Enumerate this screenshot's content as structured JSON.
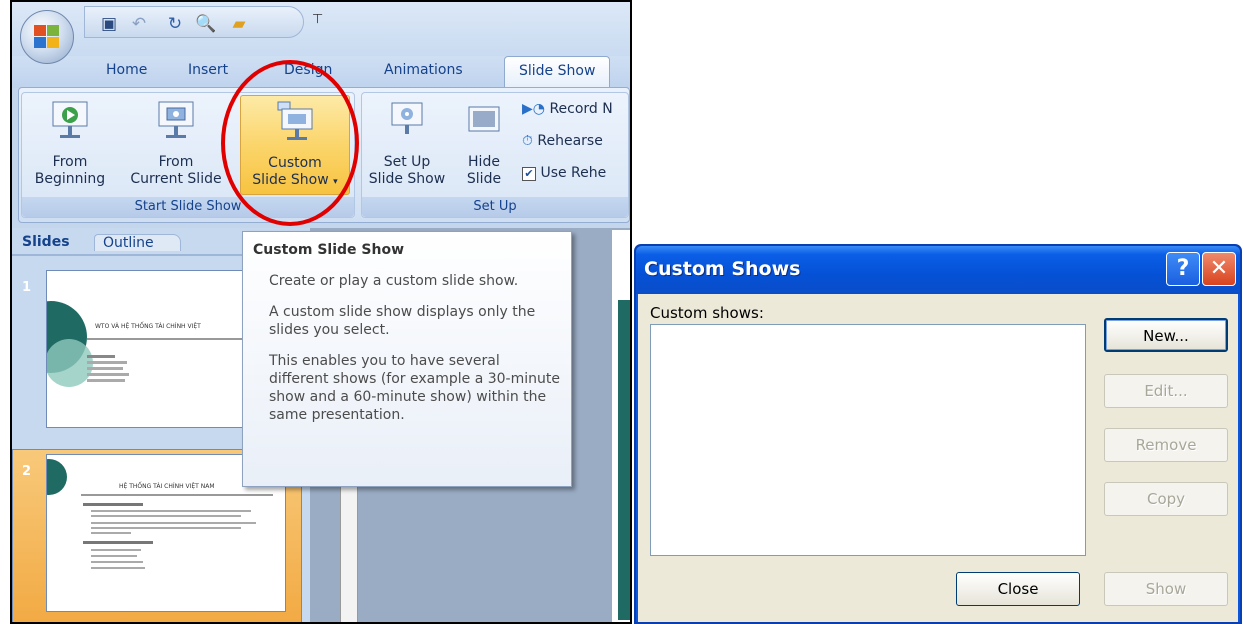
{
  "ribbon": {
    "tabs": [
      "Home",
      "Insert",
      "Design",
      "Animations",
      "Slide Show"
    ],
    "active_tab": "Slide Show",
    "groups": {
      "start_slide_show": {
        "label": "Start Slide Show",
        "from_beginning": [
          "From",
          "Beginning"
        ],
        "from_current": [
          "From",
          "Current Slide"
        ],
        "custom": [
          "Custom",
          "Slide Show"
        ]
      },
      "set_up": {
        "label": "Set Up",
        "setup_show": [
          "Set Up",
          "Slide Show"
        ],
        "hide_slide": [
          "Hide",
          "Slide"
        ],
        "record": "Record N",
        "rehearse": "Rehearse",
        "use_rehearsed": "Use Rehe"
      }
    }
  },
  "panel": {
    "tab_slides": "Slides",
    "tab_outline": "Outline",
    "slides": [
      {
        "number": "1",
        "title": "WTO VÀ HỆ THỐNG TÀI CHÍNH VIỆT"
      },
      {
        "number": "2",
        "title": "HỆ THỐNG TÀI CHÍNH VIỆT NAM"
      }
    ]
  },
  "tooltip": {
    "title": "Custom Slide Show",
    "paragraphs": [
      "Create or play a custom slide show.",
      "A custom slide show displays only the slides you select.",
      "This enables you to have several different shows (for example a 30-minute show and a 60-minute show) within the same presentation."
    ]
  },
  "dialog": {
    "title": "Custom Shows",
    "help_glyph": "?",
    "close_glyph": "✕",
    "list_label": "Custom shows:",
    "buttons": {
      "new": "New...",
      "edit": "Edit...",
      "remove": "Remove",
      "copy": "Copy",
      "close": "Close",
      "show": "Show"
    }
  }
}
